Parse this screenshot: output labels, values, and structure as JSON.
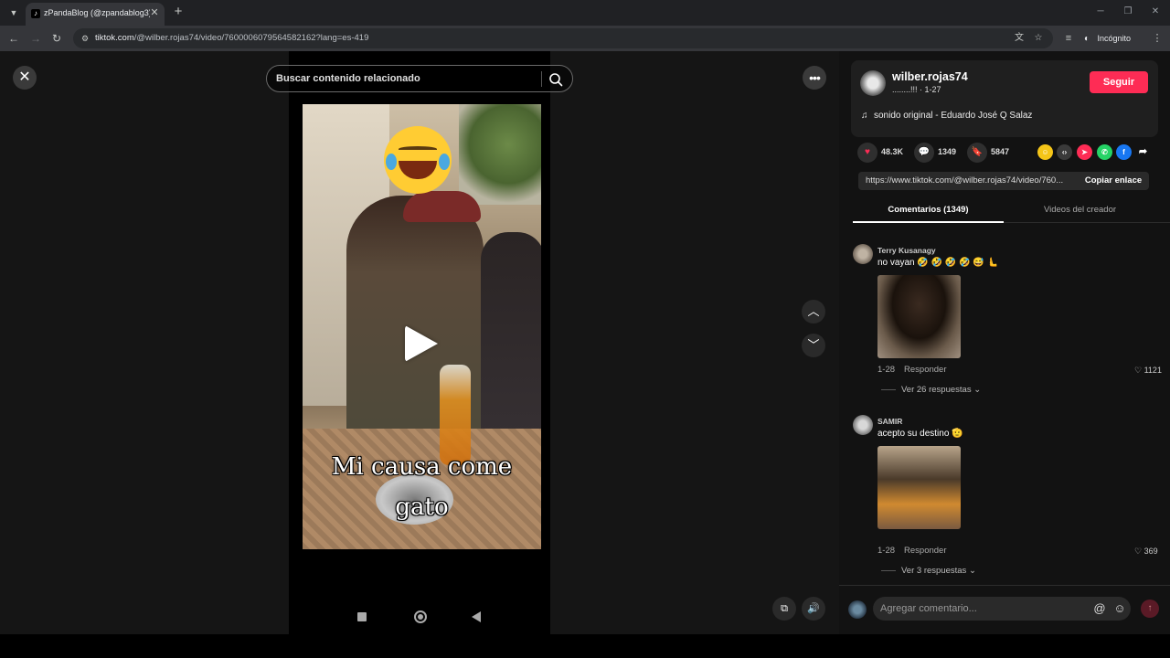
{
  "browser": {
    "tab_title": "zPandaBlog (@zpandablog3) | TikTok",
    "tab_favicon": "tiktok-logo",
    "url_host": "tiktok.com",
    "url_path": "/@wilber.rojas74/video/7600006079564582162?lang=es-419",
    "profile_label": "Incógnito"
  },
  "search": {
    "placeholder": "Buscar contenido relacionado"
  },
  "video": {
    "caption": "Mi causa come gato"
  },
  "creator": {
    "name": "wilber.rojas74",
    "subtitle": "........!!! · 1-27",
    "follow_label": "Seguir",
    "music": "sonido original - Eduardo José Q Salaz"
  },
  "stats": {
    "likes": "48.3K",
    "comments": "1349",
    "saves": "5847"
  },
  "share_colors": {
    "friends": "#f5c518",
    "embed": "#3a3a3a",
    "send": "#fe2c55",
    "whatsapp": "#25d366",
    "facebook": "#1877f2"
  },
  "link": {
    "url": "https://www.tiktok.com/@wilber.rojas74/video/760...",
    "copy_label": "Copiar enlace"
  },
  "tabs": [
    {
      "label": "Comentarios (1349)"
    },
    {
      "label": "Videos del creador"
    }
  ],
  "comments": [
    {
      "user": "Terry Kusanagy",
      "text": "no vayan 🤣 🤣 🤣 🤣 😅 🫷",
      "date": "1-28",
      "reply_label": "Responder",
      "likes": "1121",
      "replies_label": "Ver 26 respuestas"
    },
    {
      "user": "SAMIR",
      "text": "acepto su destino 🫡",
      "date": "1-28",
      "reply_label": "Responder",
      "likes": "369",
      "replies_label": "Ver 3 respuestas"
    }
  ],
  "comment_box": {
    "placeholder": "Agregar comentario..."
  }
}
